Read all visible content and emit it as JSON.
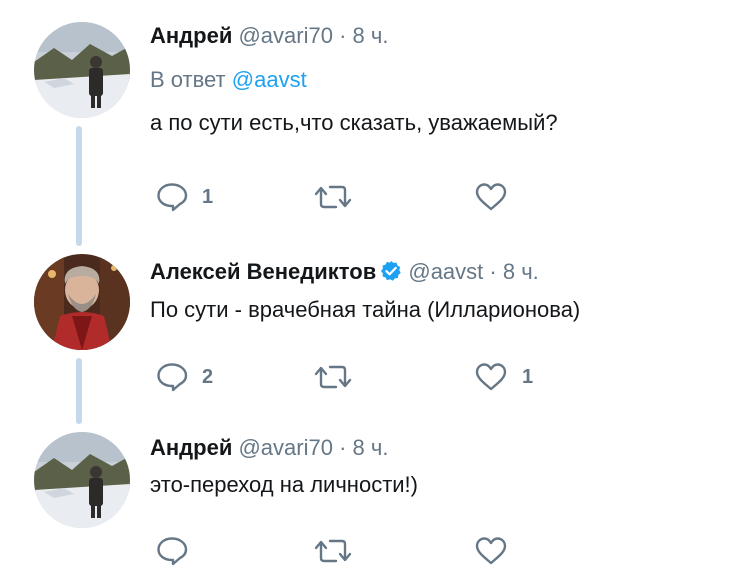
{
  "tweets": [
    {
      "name": "Андрей",
      "handle": "@avari70",
      "separator": "·",
      "time": "8 ч.",
      "reply_prefix": "В ответ",
      "reply_to": "@aavst",
      "text": "а по сути есть,что сказать, уважаемый?",
      "replies": "1",
      "retweets": "",
      "likes": ""
    },
    {
      "name": "Алексей Венедиктов",
      "verified": true,
      "handle": "@aavst",
      "separator": "·",
      "time": "8 ч.",
      "text": "По сути - врачебная тайна (Илларионова)",
      "replies": "2",
      "retweets": "",
      "likes": "1"
    },
    {
      "name": "Андрей",
      "handle": "@avari70",
      "separator": "·",
      "time": "8 ч.",
      "text": "это-переход на личности!)",
      "replies": "",
      "retweets": "",
      "likes": ""
    }
  ],
  "icons": {
    "reply": "speech-bubble-icon",
    "retweet": "retweet-icon",
    "like": "heart-icon",
    "verified": "verified-badge-icon"
  },
  "colors": {
    "link": "#1da1f2",
    "muted": "#657786",
    "thread_line": "#c4d9ec",
    "verified": "#1da1f2"
  }
}
